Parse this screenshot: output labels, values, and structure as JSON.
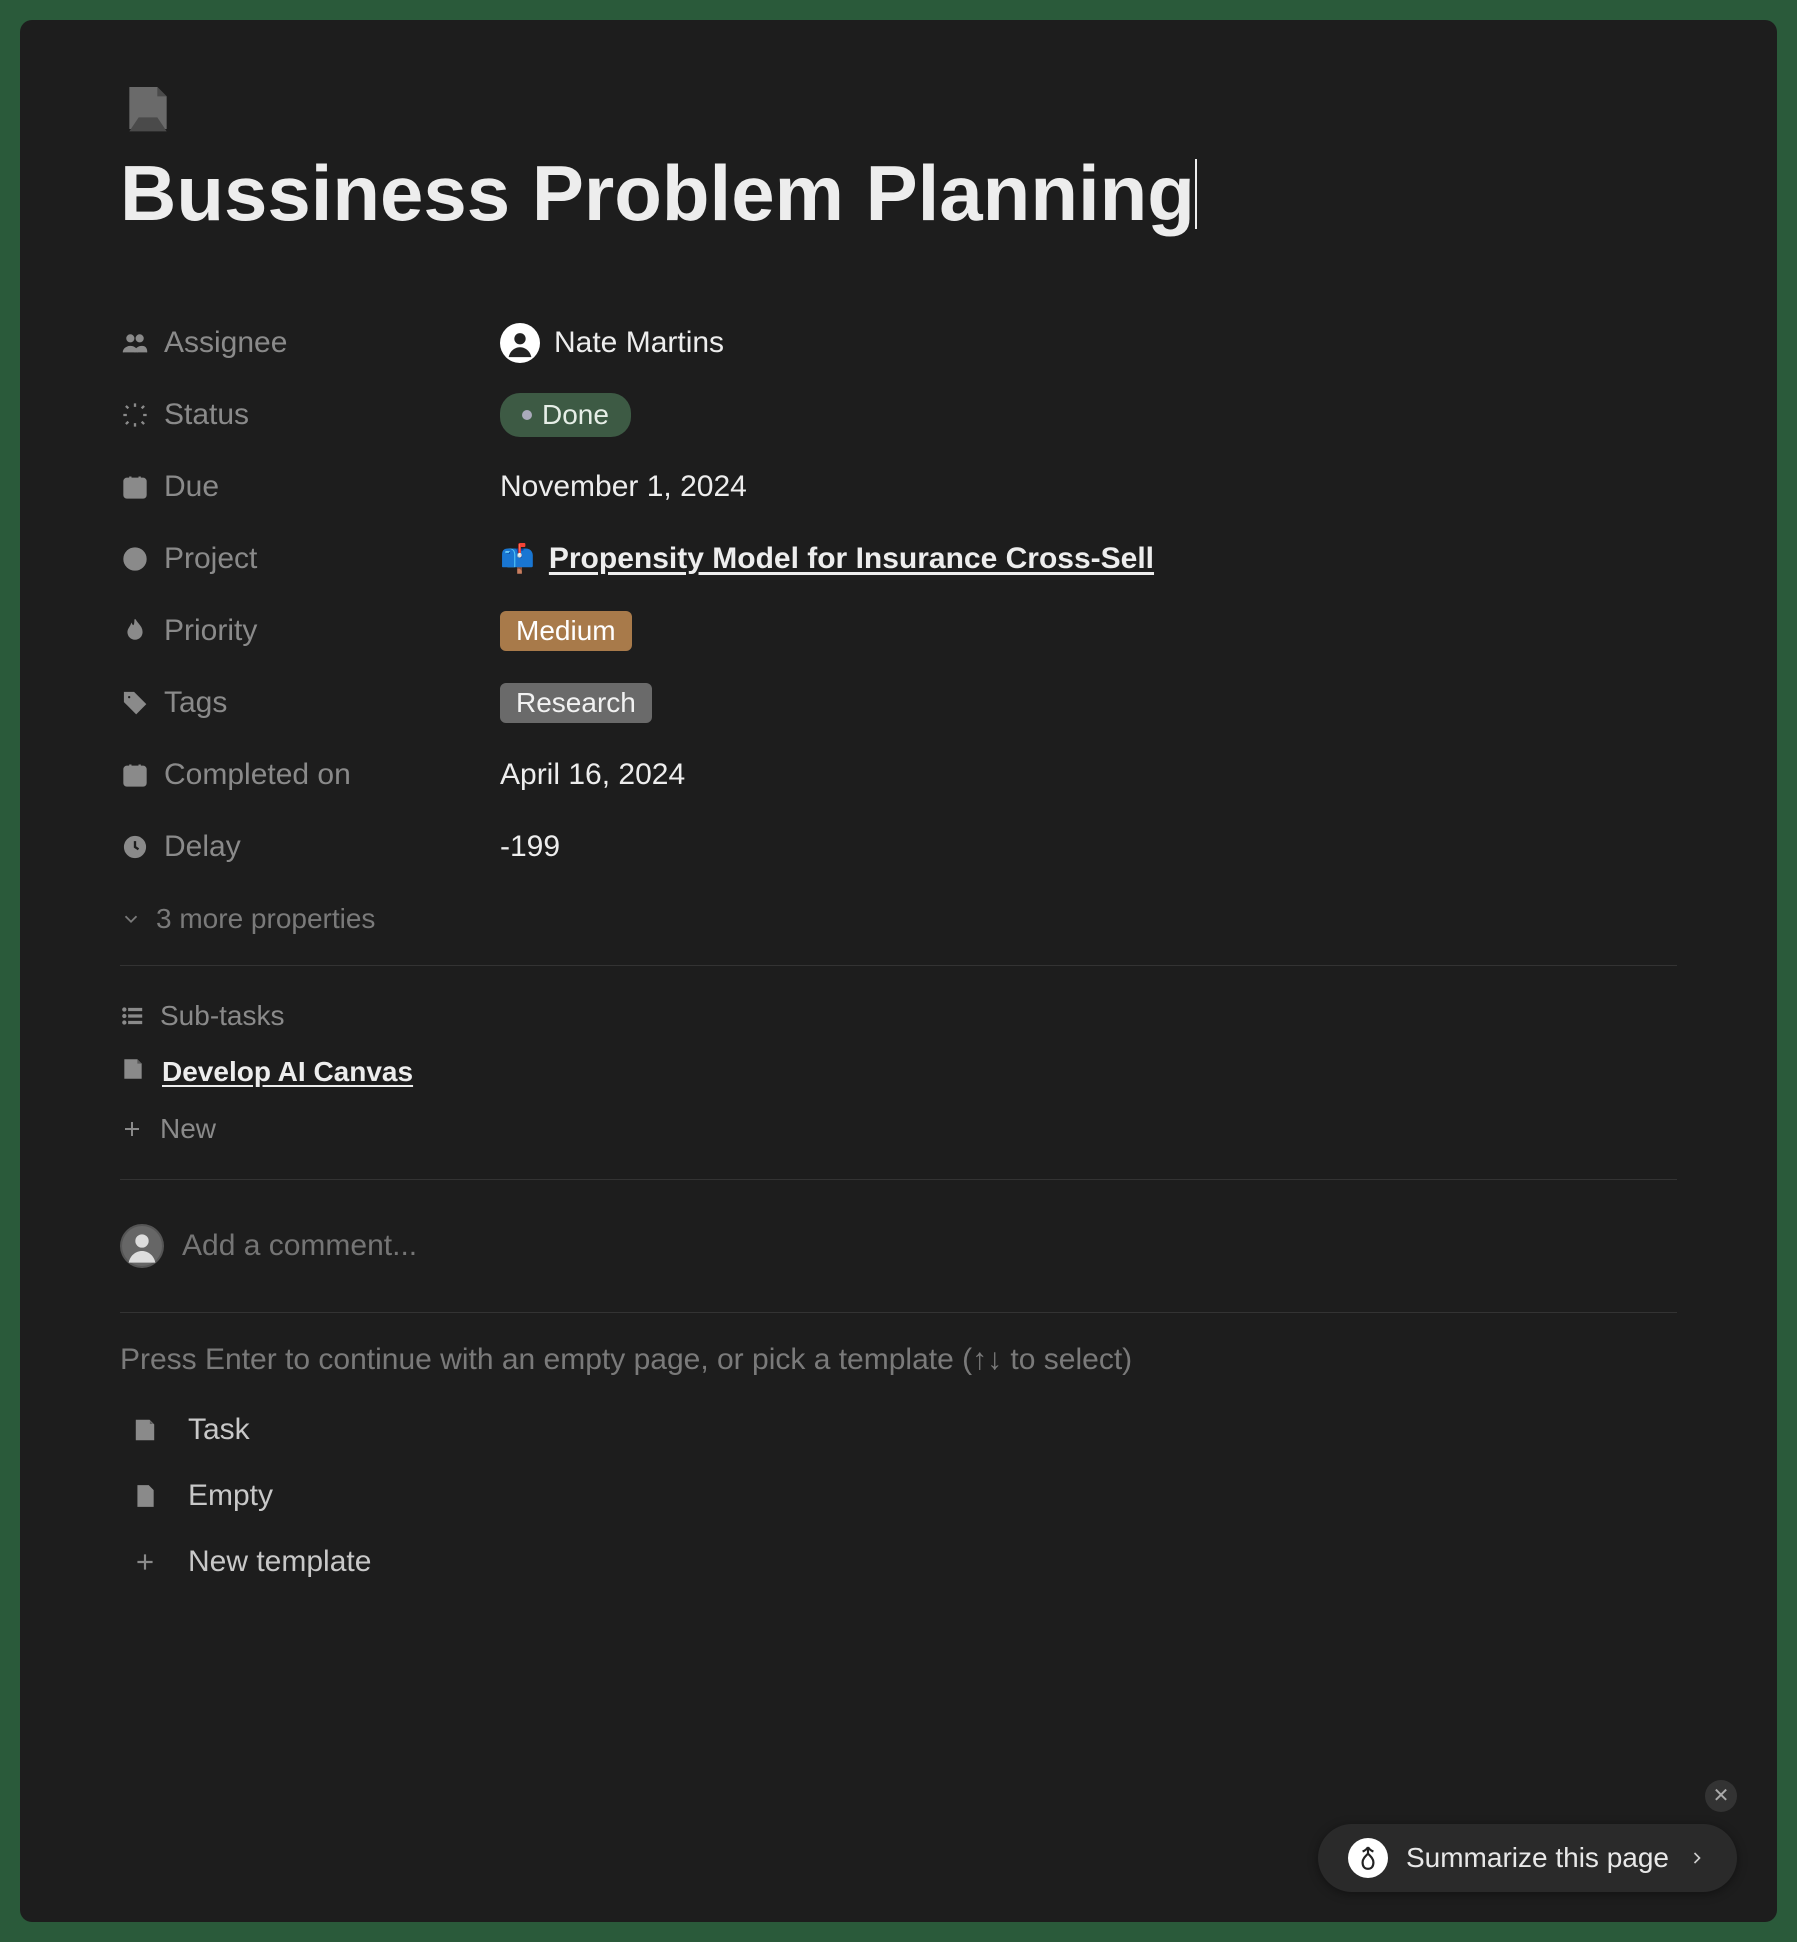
{
  "page": {
    "title": "Bussiness Problem Planning"
  },
  "properties": {
    "assignee": {
      "label": "Assignee",
      "value": "Nate Martins"
    },
    "status": {
      "label": "Status",
      "value": "Done"
    },
    "due": {
      "label": "Due",
      "value": "November 1, 2024"
    },
    "project": {
      "label": "Project",
      "value": "Propensity Model for Insurance Cross-Sell",
      "emoji": "📫"
    },
    "priority": {
      "label": "Priority",
      "value": "Medium"
    },
    "tags": {
      "label": "Tags",
      "value": "Research"
    },
    "completed_on": {
      "label": "Completed on",
      "value": "April 16, 2024"
    },
    "delay": {
      "label": "Delay",
      "value": "-199"
    },
    "more_count_label": "3 more properties"
  },
  "subtasks": {
    "header": "Sub-tasks",
    "items": [
      {
        "title": "Develop AI Canvas"
      }
    ],
    "new_label": "New"
  },
  "comment": {
    "placeholder": "Add a comment..."
  },
  "empty_state": {
    "hint": "Press Enter to continue with an empty page, or pick a template (↑↓ to select)",
    "options": [
      {
        "label": "Task",
        "icon": "page"
      },
      {
        "label": "Empty",
        "icon": "file"
      },
      {
        "label": "New template",
        "icon": "plus"
      }
    ]
  },
  "summarize": {
    "label": "Summarize this page"
  }
}
